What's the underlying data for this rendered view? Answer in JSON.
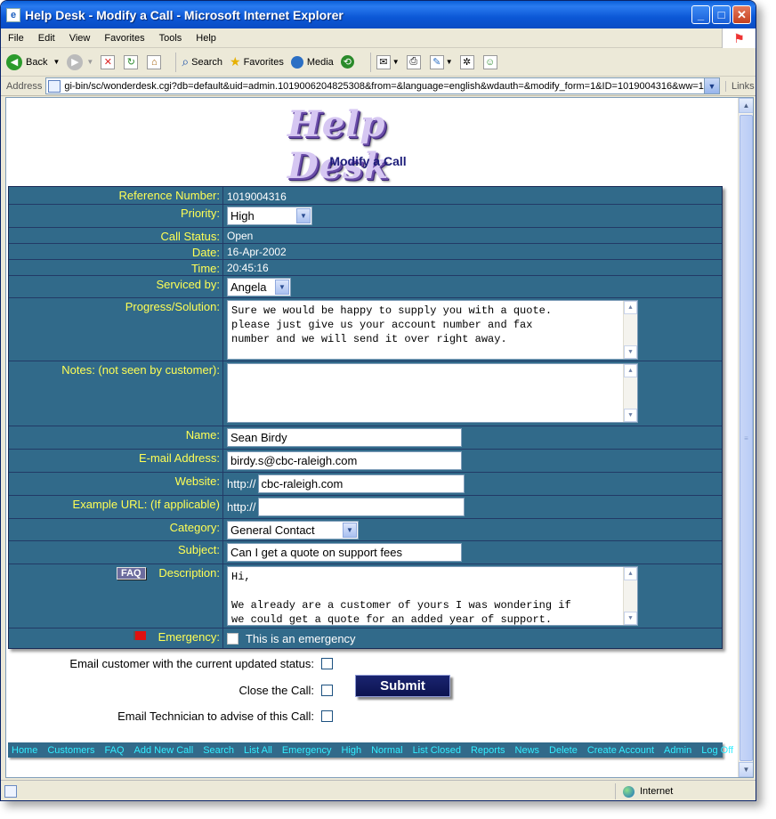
{
  "window": {
    "title": "Help Desk - Modify a Call - Microsoft Internet Explorer",
    "min": "_",
    "max": "□",
    "close": "✕"
  },
  "menu": [
    "File",
    "Edit",
    "View",
    "Favorites",
    "Tools",
    "Help"
  ],
  "toolbar": {
    "back": "Back",
    "search": "Search",
    "favorites": "Favorites",
    "media": "Media"
  },
  "address": {
    "label": "Address",
    "url": "gi-bin/sc/wonderdesk.cgi?db=default&uid=admin.1019006204825308&from=&language=english&wdauth=&modify_form=1&ID=1019004316&ww=1",
    "links": "Links"
  },
  "page": {
    "logo_text": "Help Desk",
    "heading": "Modify a Call"
  },
  "form": {
    "reference_label": "Reference Number:",
    "reference_value": "1019004316",
    "priority_label": "Priority:",
    "priority_value": "High",
    "status_label": "Call Status:",
    "status_value": "Open",
    "date_label": "Date:",
    "date_value": "16-Apr-2002",
    "time_label": "Time:",
    "time_value": "20:45:16",
    "serviced_label": "Serviced by:",
    "serviced_value": "Angela",
    "progress_label": "Progress/Solution:",
    "progress_value": "Sure we would be happy to supply you with a quote.\nplease just give us your account number and fax\nnumber and we will send it over right away.",
    "notes_label": "Notes: (not seen by customer):",
    "notes_value": "",
    "name_label": "Name:",
    "name_value": "Sean Birdy",
    "email_label": "E-mail Address:",
    "email_value": "birdy.s@cbc-raleigh.com",
    "website_label": "Website:",
    "http_prefix": "http://",
    "website_value": "cbc-raleigh.com",
    "example_url_label": "Example URL: (If applicable)",
    "example_url_value": "",
    "category_label": "Category:",
    "category_value": "General Contact",
    "subject_label": "Subject:",
    "subject_value": "Can I get a quote on support fees",
    "faq_label": "FAQ",
    "description_label": "Description:",
    "description_value": "Hi,\n\nWe already are a customer of yours I was wondering if\nwe could get a quote for an added year of support.",
    "emergency_label": "Emergency:",
    "emergency_text": "This is an emergency"
  },
  "options": {
    "email_customer": "Email customer with the current updated status:",
    "close_call": "Close the Call:",
    "email_tech": "Email Technician to advise of this Call:",
    "submit": "Submit"
  },
  "footer_links": [
    "Home",
    "Customers",
    "FAQ",
    "Add New Call",
    "Search",
    "List All",
    "Emergency",
    "High",
    "Normal",
    "List Closed",
    "Reports",
    "News",
    "Delete",
    "Create Account",
    "Admin",
    "Log Off"
  ],
  "status": {
    "zone": "Internet"
  },
  "colors": {
    "form_bg": "#316a8a",
    "label_color": "#ffff55",
    "footer_link": "#33eeff",
    "heading": "#1d1d7a"
  }
}
